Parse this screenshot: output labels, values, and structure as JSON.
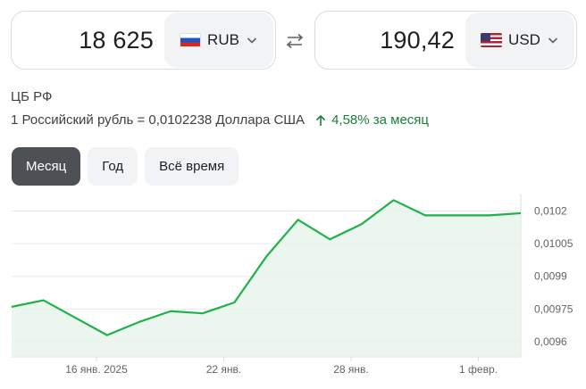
{
  "converter": {
    "from": {
      "amount": "18 625",
      "currency": "RUB",
      "flag_icon": "russia-flag-icon"
    },
    "to": {
      "amount": "190,42",
      "currency": "USD",
      "flag_icon": "usa-flag-icon"
    },
    "swap_icon": "swap-arrows-icon"
  },
  "rate_info": {
    "source": "ЦБ РФ",
    "rate_text": "1 Российский рубль = 0,0102238 Доллара США",
    "change": "4,58% за месяц",
    "change_icon": "arrow-up-icon",
    "change_color": "#188038"
  },
  "tabs": [
    {
      "label": "Месяц",
      "active": true
    },
    {
      "label": "Год",
      "active": false
    },
    {
      "label": "Всё время",
      "active": false
    }
  ],
  "chart_data": {
    "type": "area",
    "title": "",
    "xlabel": "",
    "ylabel": "",
    "x_tick_labels": [
      "16 янв. 2025",
      "22 янв.",
      "28 янв.",
      "1 февр."
    ],
    "y_tick_labels": [
      "0,0102",
      "0,01005",
      "0,0099",
      "0,00975",
      "0,0096"
    ],
    "y_ticks": [
      0.0102,
      0.01005,
      0.0099,
      0.00975,
      0.0096
    ],
    "ylim": [
      0.00953,
      0.01028
    ],
    "x_tick_index": [
      4,
      10,
      16,
      22
    ],
    "values": [
      0.00976,
      0.00979,
      0.00971,
      0.00963,
      0.00969,
      0.00974,
      0.00973,
      0.00978,
      0.00999,
      0.01016,
      0.01007,
      0.01014,
      0.01025,
      0.01018,
      0.01018,
      0.01018,
      0.01019
    ],
    "x_index": [
      0,
      1.5,
      3,
      4.5,
      6,
      7.5,
      9,
      10.5,
      12,
      13.5,
      15,
      16.5,
      18,
      19.5,
      21,
      22.5,
      24
    ],
    "x_range": [
      0,
      24
    ],
    "line_color": "#1fb14a",
    "fill_color": "#e6f4ea",
    "grid": true
  }
}
